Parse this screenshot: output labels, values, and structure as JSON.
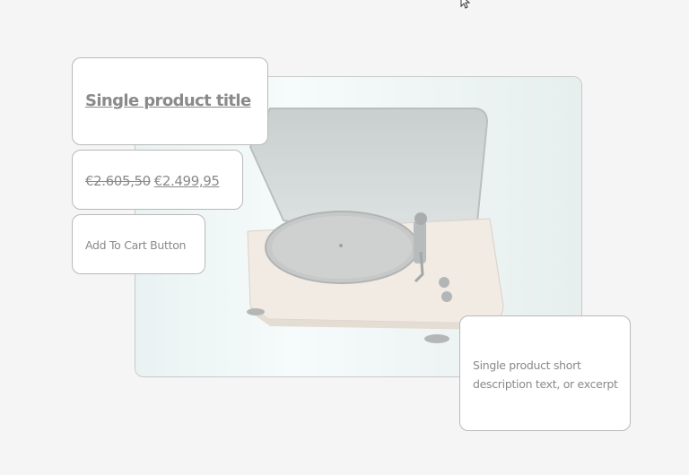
{
  "product": {
    "title": "Single product title",
    "price_old": "€2.605,50",
    "price_new": "€2.499,95",
    "add_to_cart_label": "Add To Cart Button",
    "short_description": "Single product short description text, or excerpt",
    "image_alt": "turntable-record-player-image"
  },
  "cursor": {
    "icon": "mouse-pointer-icon"
  }
}
